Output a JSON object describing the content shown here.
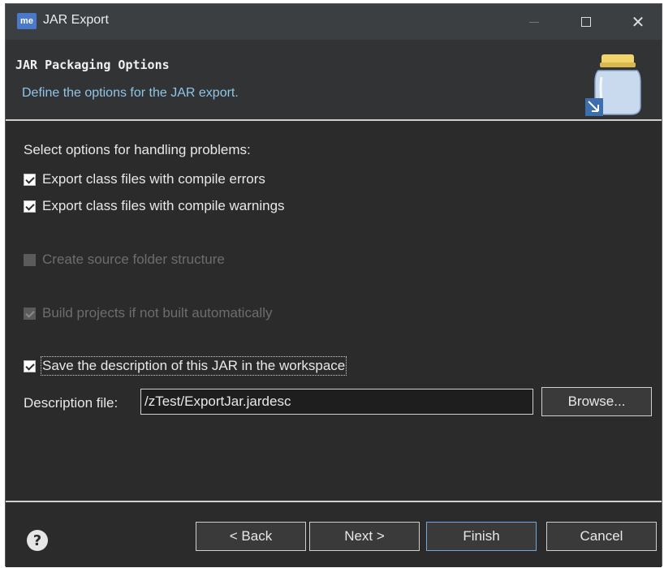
{
  "window": {
    "app_icon_text": "me",
    "title": "JAR Export"
  },
  "header": {
    "page_title": "JAR Packaging Options",
    "description": "Define the options for the JAR export."
  },
  "options": {
    "section_label": "Select options for handling problems:",
    "export_errors": {
      "label": "Export class files with compile errors",
      "checked": true,
      "enabled": true
    },
    "export_warnings": {
      "label": "Export class files with compile warnings",
      "checked": true,
      "enabled": true
    },
    "create_source_folder": {
      "label": "Create source folder structure",
      "checked": false,
      "enabled": false
    },
    "build_projects": {
      "label": "Build projects if not built automatically",
      "checked": true,
      "enabled": false
    },
    "save_description": {
      "label": "Save the description of this JAR in the workspace",
      "checked": true,
      "enabled": true
    }
  },
  "description_file": {
    "label": "Description file:",
    "value": "/zTest/ExportJar.jardesc",
    "browse_label": "Browse..."
  },
  "footer": {
    "help_symbol": "?",
    "back_label": "< Back",
    "next_label": "Next >",
    "finish_label": "Finish",
    "cancel_label": "Cancel"
  },
  "colors": {
    "background": "#2b2b2b",
    "header_background": "#313335",
    "description_text": "#8fc6e8",
    "focus_border": "#6fa8dc"
  },
  "icons": {
    "app": "me-app-icon",
    "banner": "jar-icon",
    "help": "help-icon"
  }
}
